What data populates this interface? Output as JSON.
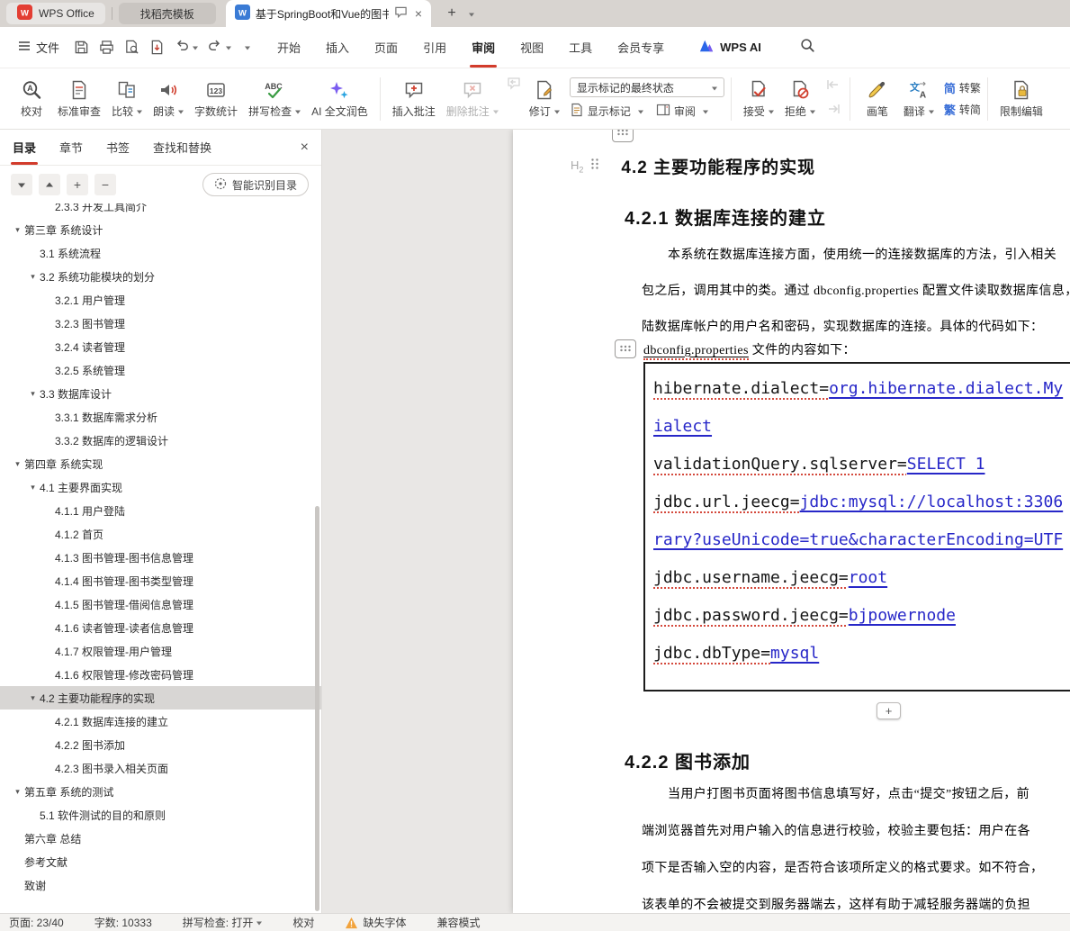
{
  "colors": {
    "accent_red": "#d23b2b",
    "link_blue": "#2727c8",
    "warn_orange": "#f2a33c",
    "code_misspell_red": "#d4493c"
  },
  "tabbar": {
    "home_label": "WPS Office",
    "docer_label": "找稻壳模板",
    "doc_label": "基于SpringBoot和Vue的图书管理系统"
  },
  "menubar": {
    "file": "文件",
    "tabs": [
      {
        "label": "开始"
      },
      {
        "label": "插入"
      },
      {
        "label": "页面"
      },
      {
        "label": "引用"
      },
      {
        "label": "审阅",
        "active": true
      },
      {
        "label": "视图"
      },
      {
        "label": "工具"
      },
      {
        "label": "会员专享"
      }
    ],
    "wps_ai": "WPS AI"
  },
  "ribbon": {
    "proofread": "校对",
    "std_review": "标准审查",
    "compare": "比较",
    "read_aloud": "朗读",
    "word_count": "字数统计",
    "spell_check": "拼写检查",
    "ai_polish": "AI 全文润色",
    "insert_comment": "插入批注",
    "delete_comment": "删除批注",
    "track_changes": "修订",
    "markup_select": "显示标记的最终状态",
    "show_markup": "显示标记",
    "review_pane": "审阅",
    "accept": "接受",
    "reject": "拒绝",
    "pen": "画笔",
    "translate": "翻译",
    "jf_trad_icon": "简",
    "to_trad": "转繁",
    "jf_simp_icon": "繁",
    "to_simp": "转简",
    "restrict": "限制编辑"
  },
  "sidebar": {
    "tabs": [
      {
        "label": "目录",
        "active": true
      },
      {
        "label": "章节"
      },
      {
        "label": "书签"
      },
      {
        "label": "查找和替换"
      }
    ],
    "smart_recognize": "智能识别目录",
    "tree": [
      {
        "label": "2.3.3 开发工具简介",
        "level": 2,
        "arrow": false,
        "clip": true
      },
      {
        "label": "第三章 系统设计",
        "level": 0,
        "arrow": true
      },
      {
        "label": "3.1 系统流程",
        "level": 1,
        "arrow": false
      },
      {
        "label": "3.2 系统功能模块的划分",
        "level": 1,
        "arrow": true
      },
      {
        "label": "3.2.1 用户管理",
        "level": 2,
        "arrow": false
      },
      {
        "label": "3.2.3 图书管理",
        "level": 2,
        "arrow": false
      },
      {
        "label": "3.2.4 读者管理",
        "level": 2,
        "arrow": false
      },
      {
        "label": "3.2.5 系统管理",
        "level": 2,
        "arrow": false
      },
      {
        "label": "3.3 数据库设计",
        "level": 1,
        "arrow": true
      },
      {
        "label": "3.3.1 数据库需求分析",
        "level": 2,
        "arrow": false
      },
      {
        "label": "3.3.2 数据库的逻辑设计",
        "level": 2,
        "arrow": false
      },
      {
        "label": "第四章 系统实现",
        "level": 0,
        "arrow": true
      },
      {
        "label": "4.1 主要界面实现",
        "level": 1,
        "arrow": true
      },
      {
        "label": "4.1.1 用户登陆",
        "level": 2,
        "arrow": false
      },
      {
        "label": "4.1.2 首页",
        "level": 2,
        "arrow": false
      },
      {
        "label": "4.1.3 图书管理-图书信息管理",
        "level": 2,
        "arrow": false
      },
      {
        "label": "4.1.4 图书管理-图书类型管理",
        "level": 2,
        "arrow": false
      },
      {
        "label": "4.1.5 图书管理-借阅信息管理",
        "level": 2,
        "arrow": false
      },
      {
        "label": "4.1.6 读者管理-读者信息管理",
        "level": 2,
        "arrow": false
      },
      {
        "label": "4.1.7 权限管理-用户管理",
        "level": 2,
        "arrow": false
      },
      {
        "label": "4.1.6 权限管理-修改密码管理",
        "level": 2,
        "arrow": false
      },
      {
        "label": "4.2 主要功能程序的实现",
        "level": 1,
        "arrow": true,
        "selected": true
      },
      {
        "label": "4.2.1 数据库连接的建立",
        "level": 2,
        "arrow": false
      },
      {
        "label": "4.2.2 图书添加",
        "level": 2,
        "arrow": false
      },
      {
        "label": "4.2.3 图书录入相关页面",
        "level": 2,
        "arrow": false
      },
      {
        "label": "第五章 系统的测试",
        "level": 0,
        "arrow": true
      },
      {
        "label": "5.1  软件测试的目的和原则",
        "level": 1,
        "arrow": false
      },
      {
        "label": "第六章  总结",
        "level": 0,
        "arrow": false
      },
      {
        "label": "参考文献",
        "level": 0,
        "arrow": false
      },
      {
        "label": "致谢",
        "level": 0,
        "arrow": false
      }
    ]
  },
  "document": {
    "h_marker": "H",
    "h_marker_sub": "2",
    "heading_42": "4.2 主要功能程序的实现",
    "heading_421": "4.2.1 数据库连接的建立",
    "para1": [
      "本系统在数据库连接方面，使用统一的连接数据库的方法，引入相关",
      "包之后，调用其中的类。通过 dbconfig.properties 配置文件读取数据库信息，登",
      "陆数据库帐户的用户名和密码，实现数据库的连接。具体的代码如下："
    ],
    "caption_word": "dbconfig.properties",
    "caption_rest": " 文件的内容如下：",
    "code_lines": [
      [
        {
          "t": "hibernate.dialect=",
          "s": "p"
        },
        {
          "t": "org.hibernate.dialect.My",
          "s": "l"
        }
      ],
      [
        {
          "t": "ialect",
          "s": "l"
        }
      ],
      [
        {
          "t": "validationQuery.sqlserver=",
          "s": "p"
        },
        {
          "t": "SELECT 1",
          "s": "l"
        }
      ],
      [
        {
          "t": "jdbc.url.jeecg=",
          "s": "p"
        },
        {
          "t": "jdbc:mysql://localhost:3306",
          "s": "l"
        }
      ],
      [
        {
          "t": "rary?useUnicode=true&characterEncoding=UTF",
          "s": "l"
        }
      ],
      [
        {
          "t": "jdbc.username.jeecg=",
          "s": "p"
        },
        {
          "t": "root",
          "s": "l"
        }
      ],
      [
        {
          "t": "jdbc.password.jeecg=",
          "s": "p"
        },
        {
          "t": "bjpowernode",
          "s": "l"
        }
      ],
      [
        {
          "t": "jdbc.dbType=",
          "s": "p"
        },
        {
          "t": "mysql",
          "s": "l"
        }
      ]
    ],
    "heading_422": "4.2.2 图书添加",
    "para2": [
      "当用户打图书页面将图书信息填写好，点击“提交”按钮之后，前",
      "端浏览器首先对用户输入的信息进行校验，校验主要包括：用户在各",
      "项下是否输入空的内容，是否符合该项所定义的格式要求。如不符合，",
      "该表单的不会被提交到服务器端去，这样有助于减轻服务器端的负担"
    ]
  },
  "statusbar": {
    "page": "页面: 23/40",
    "words": "字数: 10333",
    "spell": "拼写检查: 打开",
    "proofread": "校对",
    "missing_font": "缺失字体",
    "compat": "兼容模式"
  }
}
